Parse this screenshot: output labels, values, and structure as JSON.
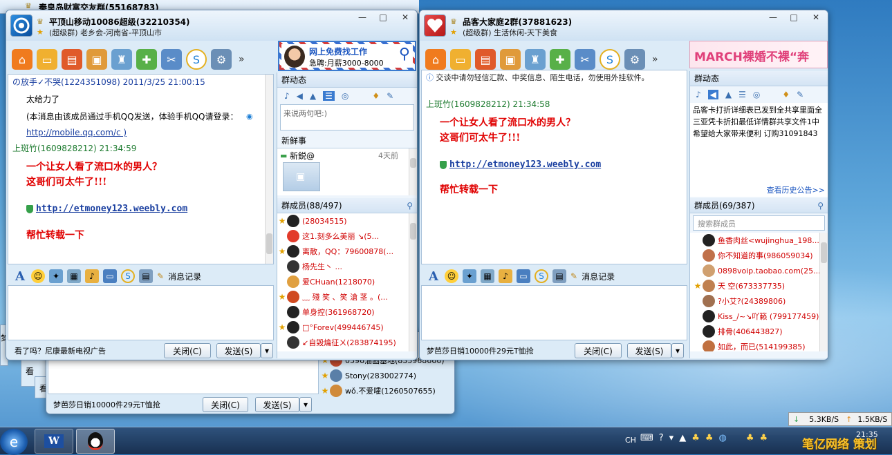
{
  "background_windows": {
    "top_title": "秦皇岛财富交友群(55168783)",
    "left_strip_1": "看",
    "left_strip_2": "看",
    "left_strip_3": "梦",
    "third_window": {
      "footer_ad": "梦芭莎日销10000件29元T恤抢",
      "close_label": "关闭(C)",
      "send_label": "发送(S)",
      "members": [
        {
          "name": "0596油画基地(835968666)"
        },
        {
          "name": "Stony(283002774)"
        },
        {
          "name": "wǒ.不爱嚯(1260507655)"
        }
      ]
    }
  },
  "window_left": {
    "title": "平顶山移动10086超级(32210354)",
    "subtitle": "(超级群) 老乡会-河南省-平顶山市",
    "ad_line1": "网上免费找工作",
    "ad_line2": "急聘:月薪3000-8000",
    "messages": {
      "sender1": "の放手✓不哭(1224351098) 2011/3/25 21:00:15",
      "body1": "太给力了",
      "body2": "(本消息由该成员通过手机QQ发送，体验手机QQ请登录：",
      "body3": "http://mobile.qq.com/c )",
      "sender2": "上斑竹(1609828212)  21:34:59",
      "red1": "一个让女人看了流口水的男人？",
      "red2": "这哥们可太牛了!!!",
      "link": "http://etmoney123.weebly.com",
      "red3": "帮忙转载一下"
    },
    "history_label": "消息记录",
    "footer_ad": "看了吗？尼康最新电视广告",
    "close_label": "关闭(C)",
    "send_label": "发送(S)",
    "side": {
      "dynamics_label": "群动态",
      "status_placeholder": "来说两句吧:)",
      "news_label": "新鲜事",
      "news_item": "新鋭@",
      "news_time": "4天前",
      "members_label": "群成员(88/497)",
      "members": [
        {
          "name": "(28034515)",
          "star": true
        },
        {
          "name": "这1.刻多么美丽 ↘(5...",
          "star": false
        },
        {
          "name": "离散，QQ：79600878(...",
          "star": true
        },
        {
          "name": "杨先生丶        ...",
          "star": false
        },
        {
          "name": "爱CHuan(1218070)",
          "star": false
        },
        {
          "name": "﹏ 殘 笑 、笑 滄 茎 。(...",
          "star": true
        },
        {
          "name": "单身控(361968720)",
          "star": false
        },
        {
          "name": "□°Forev(499446745)",
          "star": true
        },
        {
          "name": "↙自毁爚征ㄨ(283874195)",
          "star": false
        }
      ]
    }
  },
  "window_right": {
    "title": "品客大家庭2群(37881623)",
    "subtitle": "(超级群) 生活休闲-天下美食",
    "ad_text": "MARCH裸婚不裸“奔",
    "notice": "交谈中请勿轻信汇款、中奖信息、陌生电话，勿使用外挂软件。",
    "messages": {
      "sender": "上斑竹(1609828212)  21:34:58",
      "red1": "一个让女人看了流口水的男人？",
      "red2": "这哥们可太牛了!!!",
      "link": "http://etmoney123.weebly.com",
      "red3": "帮忙转载一下"
    },
    "history_label": "消息记录",
    "footer_ad": "梦芭莎日销10000件29元T恤抢",
    "close_label": "关闭(C)",
    "send_label": "发送(S)",
    "side": {
      "dynamics_label": "群动态",
      "announcement": "品客卡打折详细表已发到全共享里面全三亚凭卡折扣最低详情群共享文件1中希望给大家带来便利 订购31091843",
      "history_link": "查看历史公告>>",
      "members_label": "群成员(69/387)",
      "search_placeholder": "搜索群成员",
      "members": [
        {
          "name": "鱼香肉丝<wujinghua_198...",
          "star": false
        },
        {
          "name": "你不知道的事(986059034)",
          "star": false
        },
        {
          "name": "0898voip.taobao.com(25...",
          "star": false
        },
        {
          "name": "天 空(673337735)",
          "star": true
        },
        {
          "name": "?小艾?(24389806)",
          "star": false
        },
        {
          "name": "Kiss_/~↘吖籁 (799177459)",
          "star": false
        },
        {
          "name": "排骨(406443827)",
          "star": false
        },
        {
          "name": "如此，而已(514199385)",
          "star": false
        }
      ]
    }
  },
  "network": {
    "down": "5.3KB/S",
    "up": "1.5KB/S"
  },
  "taskbar": {
    "lang": "CH",
    "clock_time": "21:35",
    "watermark": "笔亿网络 策划"
  },
  "colors": {
    "accent_red": "#e00000",
    "link_blue": "#1a3fa0",
    "sender_green": "#1c7a2e"
  }
}
